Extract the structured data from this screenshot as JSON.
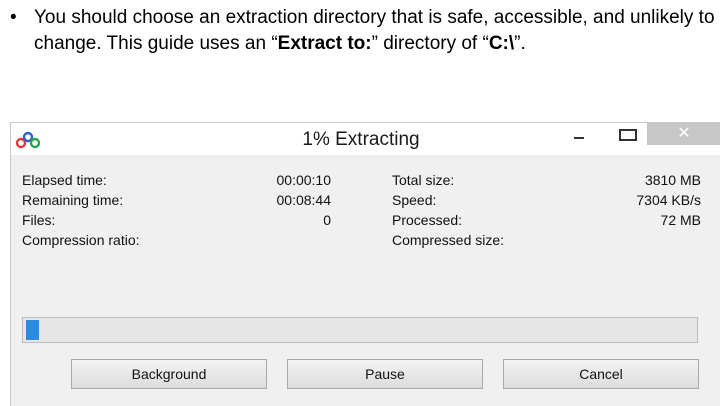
{
  "bullet": {
    "marker": "•",
    "part1": "You should choose an extraction directory that is safe, accessible, and unlikely to change. This guide uses an “",
    "bold1": "Extract to:",
    "part2": "” directory of “",
    "bold2": "C:\\",
    "part3": "”."
  },
  "window": {
    "title": "1% Extracting",
    "close_symbol": "✕",
    "progress_percent": 1,
    "colors": {
      "progress_fill": "#2b8ae2",
      "close_button": "#c7c7c7"
    },
    "stats": {
      "elapsed_label": "Elapsed time:",
      "elapsed_value": "00:00:10",
      "remaining_label": "Remaining time:",
      "remaining_value": "00:08:44",
      "files_label": "Files:",
      "files_value": "0",
      "ratio_label": "Compression ratio:",
      "total_label": "Total size:",
      "total_value": "3810 MB",
      "speed_label": "Speed:",
      "speed_value": "7304 KB/s",
      "processed_label": "Processed:",
      "processed_value": "72 MB",
      "compressed_label": "Compressed size:"
    },
    "buttons": {
      "background": "Background",
      "pause": "Pause",
      "cancel": "Cancel"
    }
  }
}
